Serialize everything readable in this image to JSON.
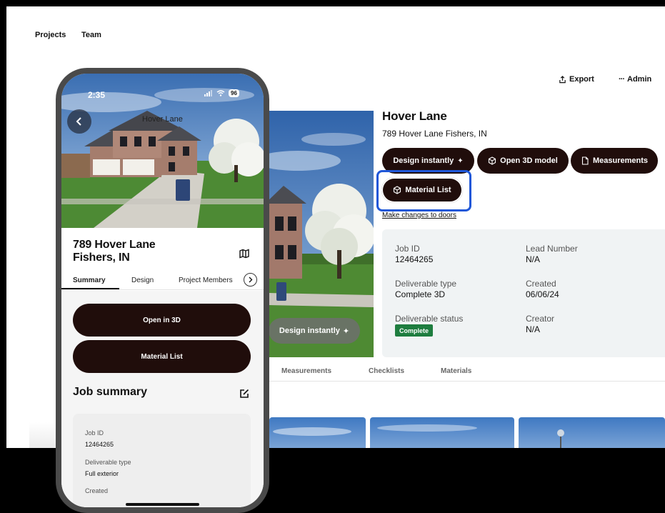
{
  "nav": {
    "projects": "Projects",
    "team": "Team"
  },
  "actions": {
    "export": "Export",
    "admin": "Admin"
  },
  "property": {
    "title": "Hover Lane",
    "address": "789 Hover Lane Fishers, IN"
  },
  "buttons": {
    "design_instantly": "Design instantly",
    "open_3d": "Open 3D model",
    "measurements": "Measurements",
    "material_list": "Material List",
    "make_changes": "Make changes to doors"
  },
  "details": {
    "job_id_label": "Job ID",
    "job_id": "12464265",
    "lead_number_label": "Lead Number",
    "lead_number": "N/A",
    "deliverable_type_label": "Deliverable type",
    "deliverable_type": "Complete 3D",
    "created_label": "Created",
    "created": "06/06/24",
    "deliverable_status_label": "Deliverable status",
    "deliverable_status": "Complete",
    "creator_label": "Creator",
    "creator": "N/A"
  },
  "tabs": [
    "Measurements",
    "Checklists",
    "Materials"
  ],
  "hero_button": "Design instantly",
  "phone": {
    "time": "2:35",
    "battery": "96",
    "photo_caption": "Hover Lane",
    "address_line1": "789 Hover Lane",
    "address_line2": "Fishers, IN",
    "tabs": [
      "Summary",
      "Design",
      "Project Members"
    ],
    "open_3d": "Open in 3D",
    "material_list": "Material List",
    "job_summary": "Job summary",
    "job_card": {
      "job_id_label": "Job ID",
      "job_id": "12464265",
      "deliverable_type_label": "Deliverable type",
      "deliverable_type": "Full exterior",
      "created_label": "Created"
    }
  },
  "colors": {
    "pill": "#200d0b",
    "highlight": "#1f57d8",
    "status_green": "#1e7d3f",
    "panel": "#f0f3f4"
  }
}
